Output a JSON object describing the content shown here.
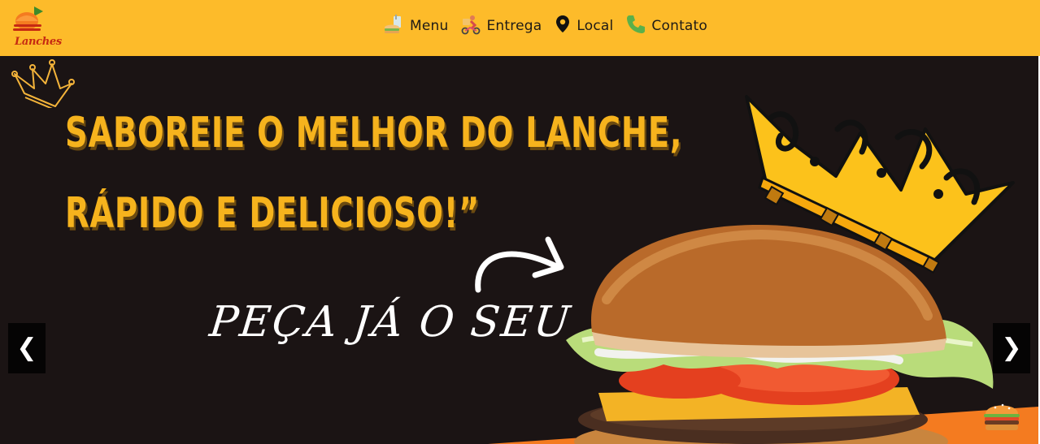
{
  "brand": {
    "logo_text": "Lanches"
  },
  "nav": {
    "items": [
      {
        "label": "Menu",
        "icon": "food-drink-icon"
      },
      {
        "label": "Entrega",
        "icon": "delivery-icon"
      },
      {
        "label": "Local",
        "icon": "location-pin-icon"
      },
      {
        "label": "Contato",
        "icon": "phone-icon"
      }
    ]
  },
  "hero": {
    "headline_line1": "SABOREIE O MELHOR DO LANCHE,",
    "headline_line2": "RÁPIDO E DELICIOSO!”",
    "cta": "PEÇA JÁ O SEU",
    "prev_label": "❮",
    "next_label": "❯"
  },
  "colors": {
    "header_bg": "#fdbb2a",
    "hero_bg": "#1b1414",
    "headline": "#f6b31d",
    "accent_orange": "#f47b20",
    "crown_yellow": "#fcc21b"
  }
}
